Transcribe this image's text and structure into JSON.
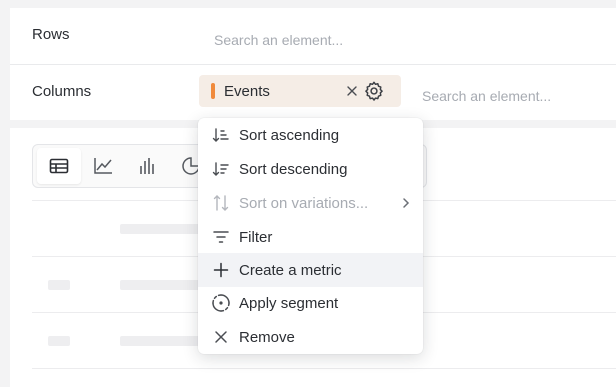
{
  "config": {
    "rows_label": "Rows",
    "rows_search_placeholder": "Search an element...",
    "columns_label": "Columns",
    "columns_search_placeholder": "Search an element...",
    "column_chip": {
      "label": "Events",
      "close_icon": "close-icon",
      "settings_icon": "gear-icon",
      "color": "#f08a3c"
    }
  },
  "viz_toolbar": {
    "buttons": [
      {
        "name": "table-view",
        "icon": "table-icon",
        "active": true
      },
      {
        "name": "line-chart-view",
        "icon": "line-chart-icon",
        "active": false
      },
      {
        "name": "bar-chart-view",
        "icon": "bar-chart-icon",
        "active": false
      },
      {
        "name": "pie-chart-view",
        "icon": "pie-chart-icon",
        "active": false
      }
    ]
  },
  "context_menu": {
    "items": [
      {
        "label": "Sort ascending",
        "icon": "sort-ascending-icon",
        "disabled": false
      },
      {
        "label": "Sort descending",
        "icon": "sort-descending-icon",
        "disabled": false
      },
      {
        "label": "Sort on variations...",
        "icon": "sort-variations-icon",
        "disabled": true,
        "submenu": true
      },
      {
        "label": "Filter",
        "icon": "filter-icon",
        "disabled": false
      },
      {
        "label": "Create a metric",
        "icon": "plus-icon",
        "disabled": false,
        "hovered": true
      },
      {
        "label": "Apply segment",
        "icon": "segment-icon",
        "disabled": false
      },
      {
        "label": "Remove",
        "icon": "close-icon",
        "disabled": false
      }
    ]
  },
  "colors": {
    "accent": "#f08a3c",
    "chip_background": "#f5ede6",
    "menu_hover": "#f2f3f6",
    "disabled_text": "#a7abb2"
  }
}
